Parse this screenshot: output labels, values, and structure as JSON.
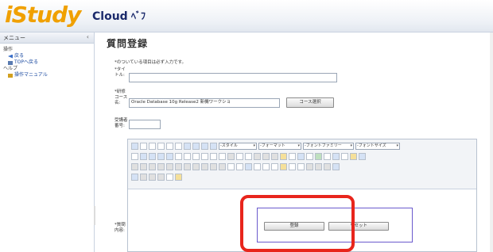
{
  "header": {
    "logo_main": "iStudy",
    "logo_cloud": "Cloud",
    "logo_suffix": "ﾍﾞﾌ"
  },
  "sidebar": {
    "title": "メニュー",
    "collapse": "‹",
    "sections": [
      {
        "label": "操作",
        "items": [
          "戻る",
          "TOPへ戻る"
        ]
      },
      {
        "label": "ヘルプ",
        "items": [
          "操作マニュアル"
        ]
      }
    ]
  },
  "main": {
    "title": "質問登録",
    "note": "*のついている項目は必ず入力です。",
    "fields": {
      "title_label": "*タイトル:",
      "course_label": "*研修コース名:",
      "course_value": "Oracle Database 10g Release2 新機ワークショ",
      "course_button": "コース選択",
      "student_label": "受講者番号:",
      "content_label": "*質問内容:"
    },
    "toolbar": {
      "style": "-スタイル",
      "format": "-フォーマット",
      "font": "-フォントファミリー",
      "font_size": "-フォントサイズ"
    },
    "buttons": {
      "submit": "登録",
      "reset": "リセット"
    }
  }
}
